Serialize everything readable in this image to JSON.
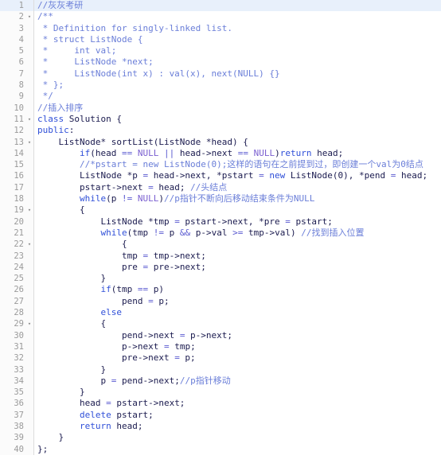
{
  "editor": {
    "name": "code-editor",
    "language": "cpp",
    "total_lines": 40,
    "active_line": 1,
    "colors": {
      "background": "#ffffff",
      "gutter_background": "#fbfbfb",
      "gutter_separator": "#dddddd",
      "line_number": "#9a9a9a",
      "active_line_highlight": "#e8f0fb",
      "text": "#1a1a4e",
      "comment": "#6a7ed8",
      "keyword": "#2f4fd8",
      "constant": "#7a5fd0",
      "operator": "#5a5ad0"
    },
    "fold_marker_glyph": "▾"
  },
  "lines": [
    {
      "number": "1",
      "fold": false,
      "active": true,
      "tokens": [
        {
          "t": "//灰灰考研",
          "c": "cm"
        }
      ]
    },
    {
      "number": "2",
      "fold": true,
      "active": false,
      "tokens": [
        {
          "t": "/**",
          "c": "cm"
        }
      ]
    },
    {
      "number": "3",
      "fold": false,
      "active": false,
      "tokens": [
        {
          "t": " * Definition for singly-linked list.",
          "c": "cm"
        }
      ]
    },
    {
      "number": "4",
      "fold": false,
      "active": false,
      "tokens": [
        {
          "t": " * struct ListNode {",
          "c": "cm"
        }
      ]
    },
    {
      "number": "5",
      "fold": false,
      "active": false,
      "tokens": [
        {
          "t": " *     int val;",
          "c": "cm"
        }
      ]
    },
    {
      "number": "6",
      "fold": false,
      "active": false,
      "tokens": [
        {
          "t": " *     ListNode *next;",
          "c": "cm"
        }
      ]
    },
    {
      "number": "7",
      "fold": false,
      "active": false,
      "tokens": [
        {
          "t": " *     ListNode(int x) : val(x), next(NULL) {}",
          "c": "cm"
        }
      ]
    },
    {
      "number": "8",
      "fold": false,
      "active": false,
      "tokens": [
        {
          "t": " * };",
          "c": "cm"
        }
      ]
    },
    {
      "number": "9",
      "fold": false,
      "active": false,
      "tokens": [
        {
          "t": " */",
          "c": "cm"
        }
      ]
    },
    {
      "number": "10",
      "fold": false,
      "active": false,
      "tokens": [
        {
          "t": "//插入排序",
          "c": "cm"
        }
      ]
    },
    {
      "number": "11",
      "fold": true,
      "active": false,
      "tokens": [
        {
          "t": "class",
          "c": "kw"
        },
        {
          "t": " Solution {",
          "c": "pl"
        }
      ]
    },
    {
      "number": "12",
      "fold": false,
      "active": false,
      "tokens": [
        {
          "t": "public",
          "c": "kw"
        },
        {
          "t": ":",
          "c": "pl"
        }
      ]
    },
    {
      "number": "13",
      "fold": true,
      "active": false,
      "tokens": [
        {
          "t": "    ListNode* sortList(ListNode *head) {",
          "c": "pl"
        }
      ]
    },
    {
      "number": "14",
      "fold": false,
      "active": false,
      "tokens": [
        {
          "t": "        ",
          "c": "pl"
        },
        {
          "t": "if",
          "c": "kw"
        },
        {
          "t": "(head ",
          "c": "pl"
        },
        {
          "t": "==",
          "c": "op"
        },
        {
          "t": " ",
          "c": "pl"
        },
        {
          "t": "NULL",
          "c": "cst"
        },
        {
          "t": " ",
          "c": "pl"
        },
        {
          "t": "||",
          "c": "op"
        },
        {
          "t": " head->next ",
          "c": "pl"
        },
        {
          "t": "==",
          "c": "op"
        },
        {
          "t": " ",
          "c": "pl"
        },
        {
          "t": "NULL",
          "c": "cst"
        },
        {
          "t": ")",
          "c": "pl"
        },
        {
          "t": "return",
          "c": "kw"
        },
        {
          "t": " head;",
          "c": "pl"
        }
      ]
    },
    {
      "number": "15",
      "fold": false,
      "active": false,
      "tokens": [
        {
          "t": "        ",
          "c": "pl"
        },
        {
          "t": "//*pstart = new ListNode(0);这样的语句在之前提到过，即创建一个val为0结点",
          "c": "cm"
        }
      ]
    },
    {
      "number": "16",
      "fold": false,
      "active": false,
      "tokens": [
        {
          "t": "        ListNode *p ",
          "c": "pl"
        },
        {
          "t": "=",
          "c": "op"
        },
        {
          "t": " head->next, *pstart ",
          "c": "pl"
        },
        {
          "t": "=",
          "c": "op"
        },
        {
          "t": " ",
          "c": "pl"
        },
        {
          "t": "new",
          "c": "kw"
        },
        {
          "t": " ListNode(",
          "c": "pl"
        },
        {
          "t": "0",
          "c": "num"
        },
        {
          "t": "), *pend ",
          "c": "pl"
        },
        {
          "t": "=",
          "c": "op"
        },
        {
          "t": " head;",
          "c": "pl"
        }
      ]
    },
    {
      "number": "17",
      "fold": false,
      "active": false,
      "tokens": [
        {
          "t": "        pstart->next ",
          "c": "pl"
        },
        {
          "t": "=",
          "c": "op"
        },
        {
          "t": " head; ",
          "c": "pl"
        },
        {
          "t": "//头结点",
          "c": "cm"
        }
      ]
    },
    {
      "number": "18",
      "fold": false,
      "active": false,
      "tokens": [
        {
          "t": "        ",
          "c": "pl"
        },
        {
          "t": "while",
          "c": "kw"
        },
        {
          "t": "(p ",
          "c": "pl"
        },
        {
          "t": "!=",
          "c": "op"
        },
        {
          "t": " ",
          "c": "pl"
        },
        {
          "t": "NULL",
          "c": "cst"
        },
        {
          "t": ")",
          "c": "pl"
        },
        {
          "t": "//p指针不断向后移动结束条件为NULL",
          "c": "cm"
        }
      ]
    },
    {
      "number": "19",
      "fold": true,
      "active": false,
      "tokens": [
        {
          "t": "        {",
          "c": "pl"
        }
      ]
    },
    {
      "number": "20",
      "fold": false,
      "active": false,
      "tokens": [
        {
          "t": "            ListNode *tmp ",
          "c": "pl"
        },
        {
          "t": "=",
          "c": "op"
        },
        {
          "t": " pstart->next, *pre ",
          "c": "pl"
        },
        {
          "t": "=",
          "c": "op"
        },
        {
          "t": " pstart;",
          "c": "pl"
        }
      ]
    },
    {
      "number": "21",
      "fold": false,
      "active": false,
      "tokens": [
        {
          "t": "            ",
          "c": "pl"
        },
        {
          "t": "while",
          "c": "kw"
        },
        {
          "t": "(tmp ",
          "c": "pl"
        },
        {
          "t": "!=",
          "c": "op"
        },
        {
          "t": " p ",
          "c": "pl"
        },
        {
          "t": "&&",
          "c": "op"
        },
        {
          "t": " p->val ",
          "c": "pl"
        },
        {
          "t": ">=",
          "c": "op"
        },
        {
          "t": " tmp->val) ",
          "c": "pl"
        },
        {
          "t": "//找到插入位置",
          "c": "cm"
        }
      ]
    },
    {
      "number": "22",
      "fold": true,
      "active": false,
      "tokens": [
        {
          "t": "                {",
          "c": "pl"
        }
      ]
    },
    {
      "number": "23",
      "fold": false,
      "active": false,
      "tokens": [
        {
          "t": "                tmp ",
          "c": "pl"
        },
        {
          "t": "=",
          "c": "op"
        },
        {
          "t": " tmp->next;",
          "c": "pl"
        }
      ]
    },
    {
      "number": "24",
      "fold": false,
      "active": false,
      "tokens": [
        {
          "t": "                pre ",
          "c": "pl"
        },
        {
          "t": "=",
          "c": "op"
        },
        {
          "t": " pre->next;",
          "c": "pl"
        }
      ]
    },
    {
      "number": "25",
      "fold": false,
      "active": false,
      "tokens": [
        {
          "t": "            }",
          "c": "pl"
        }
      ]
    },
    {
      "number": "26",
      "fold": false,
      "active": false,
      "tokens": [
        {
          "t": "            ",
          "c": "pl"
        },
        {
          "t": "if",
          "c": "kw"
        },
        {
          "t": "(tmp ",
          "c": "pl"
        },
        {
          "t": "==",
          "c": "op"
        },
        {
          "t": " p)",
          "c": "pl"
        }
      ]
    },
    {
      "number": "27",
      "fold": false,
      "active": false,
      "tokens": [
        {
          "t": "                pend ",
          "c": "pl"
        },
        {
          "t": "=",
          "c": "op"
        },
        {
          "t": " p;",
          "c": "pl"
        }
      ]
    },
    {
      "number": "28",
      "fold": false,
      "active": false,
      "tokens": [
        {
          "t": "            ",
          "c": "pl"
        },
        {
          "t": "else",
          "c": "kw"
        }
      ]
    },
    {
      "number": "29",
      "fold": true,
      "active": false,
      "tokens": [
        {
          "t": "            {",
          "c": "pl"
        }
      ]
    },
    {
      "number": "30",
      "fold": false,
      "active": false,
      "tokens": [
        {
          "t": "                pend->next ",
          "c": "pl"
        },
        {
          "t": "=",
          "c": "op"
        },
        {
          "t": " p->next;",
          "c": "pl"
        }
      ]
    },
    {
      "number": "31",
      "fold": false,
      "active": false,
      "tokens": [
        {
          "t": "                p->next ",
          "c": "pl"
        },
        {
          "t": "=",
          "c": "op"
        },
        {
          "t": " tmp;",
          "c": "pl"
        }
      ]
    },
    {
      "number": "32",
      "fold": false,
      "active": false,
      "tokens": [
        {
          "t": "                pre->next ",
          "c": "pl"
        },
        {
          "t": "=",
          "c": "op"
        },
        {
          "t": " p;",
          "c": "pl"
        }
      ]
    },
    {
      "number": "33",
      "fold": false,
      "active": false,
      "tokens": [
        {
          "t": "            }",
          "c": "pl"
        }
      ]
    },
    {
      "number": "34",
      "fold": false,
      "active": false,
      "tokens": [
        {
          "t": "            p ",
          "c": "pl"
        },
        {
          "t": "=",
          "c": "op"
        },
        {
          "t": " pend->next;",
          "c": "pl"
        },
        {
          "t": "//p指针移动",
          "c": "cm"
        }
      ]
    },
    {
      "number": "35",
      "fold": false,
      "active": false,
      "tokens": [
        {
          "t": "        }",
          "c": "pl"
        }
      ]
    },
    {
      "number": "36",
      "fold": false,
      "active": false,
      "tokens": [
        {
          "t": "        head ",
          "c": "pl"
        },
        {
          "t": "=",
          "c": "op"
        },
        {
          "t": " pstart->next;",
          "c": "pl"
        }
      ]
    },
    {
      "number": "37",
      "fold": false,
      "active": false,
      "tokens": [
        {
          "t": "        ",
          "c": "pl"
        },
        {
          "t": "delete",
          "c": "kw"
        },
        {
          "t": " pstart;",
          "c": "pl"
        }
      ]
    },
    {
      "number": "38",
      "fold": false,
      "active": false,
      "tokens": [
        {
          "t": "        ",
          "c": "pl"
        },
        {
          "t": "return",
          "c": "kw"
        },
        {
          "t": " head;",
          "c": "pl"
        }
      ]
    },
    {
      "number": "39",
      "fold": false,
      "active": false,
      "tokens": [
        {
          "t": "    }",
          "c": "pl"
        }
      ]
    },
    {
      "number": "40",
      "fold": false,
      "active": false,
      "tokens": [
        {
          "t": "};",
          "c": "pl"
        }
      ]
    }
  ]
}
